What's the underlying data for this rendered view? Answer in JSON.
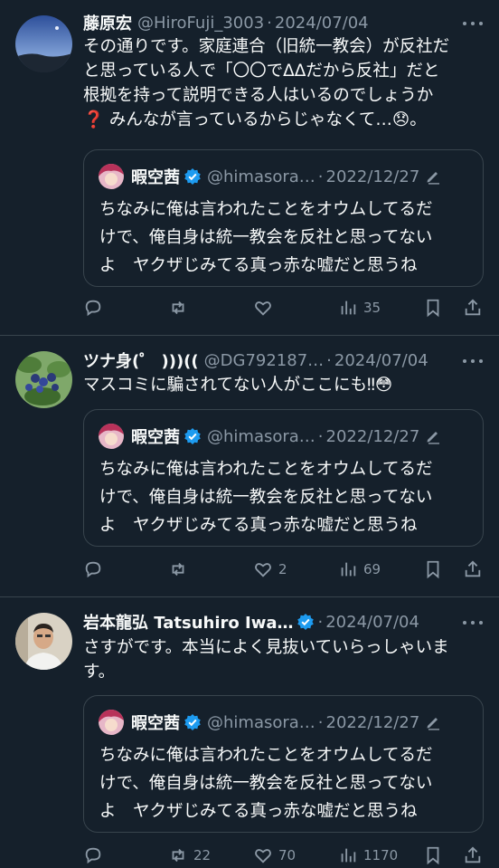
{
  "posts": [
    {
      "name": "藤原宏",
      "handle": "@HiroFuji_3003",
      "date": "2024/07/04",
      "text": [
        "その通りです。家庭連合（旧統一教会）が反社だ",
        "と思っている人で「〇〇でΔΔだから反社」だと",
        "根拠を持って説明できる人はいるのでしょうか",
        "❓ みんなが言っているからじゃなくて…😞。"
      ],
      "avatar_icon": "night-sky-avatar-icon",
      "quote": {
        "name": "暇空茜",
        "handle": "@himasora…",
        "date": "2022/12/27",
        "text": [
          "ちなみに俺は言われたことをオウムしてるだ",
          "けで、俺自身は統一教会を反社と思ってない",
          "よ　ヤクザじみてる真っ赤な嘘だと思うね"
        ]
      },
      "stats": {
        "replies": "",
        "reposts": "",
        "likes": "",
        "views": "35"
      }
    },
    {
      "name": "ツナ身(゜ )))((",
      "handle": "@DG792187…",
      "date": "2024/07/04",
      "text": [
        "マスコミに騙されてない人がここにも‼😳"
      ],
      "avatar_icon": "blueberry-plant-avatar-icon",
      "quote": {
        "name": "暇空茜",
        "handle": "@himasora…",
        "date": "2022/12/27",
        "text": [
          "ちなみに俺は言われたことをオウムしてるだ",
          "けで、俺自身は統一教会を反社と思ってない",
          "よ　ヤクザじみてる真っ赤な嘘だと思うね"
        ]
      },
      "stats": {
        "replies": "",
        "reposts": "",
        "likes": "2",
        "views": "69"
      }
    },
    {
      "name": "岩本龍弘 Tatsuhiro Iwa…",
      "handle": "",
      "date": "2024/07/04",
      "text": [
        "さすがです。本当によく見抜いていらっしゃいま",
        "す。"
      ],
      "avatar_icon": "man-portrait-avatar-icon",
      "quote": {
        "name": "暇空茜",
        "handle": "@himasora…",
        "date": "2022/12/27",
        "text": [
          "ちなみに俺は言われたことをオウムしてるだ",
          "けで、俺自身は統一教会を反社と思ってない",
          "よ　ヤクザじみてる真っ赤な嘘だと思うね"
        ]
      },
      "stats": {
        "replies": "",
        "reposts": "22",
        "likes": "70",
        "views": "1170"
      }
    }
  ],
  "separator": "·",
  "colors": {
    "background": "#15202b",
    "text": "#f7f9f9",
    "muted": "#8b98a5",
    "border": "#38444d",
    "verified": "#1d9bf0"
  }
}
